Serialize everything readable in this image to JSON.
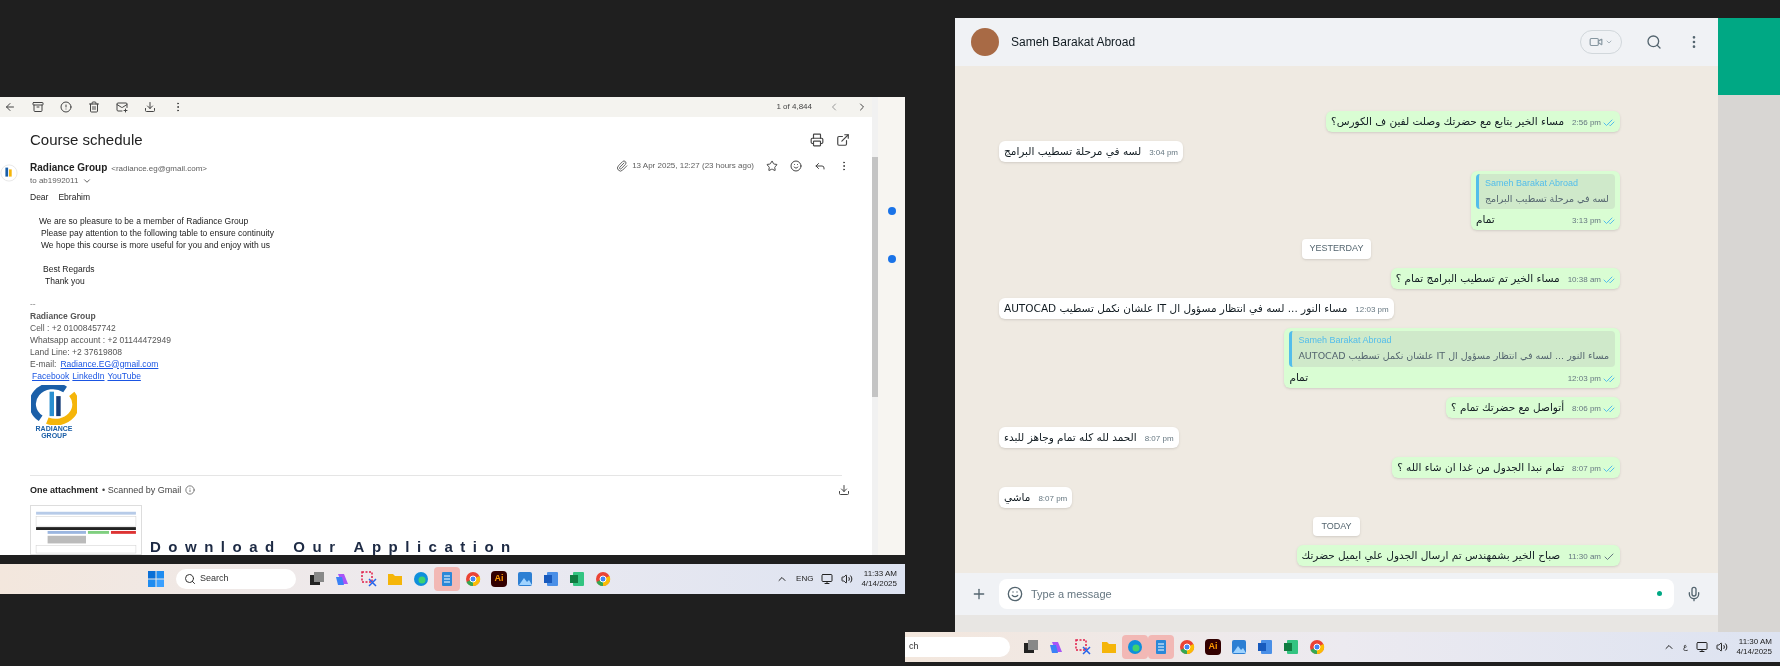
{
  "email": {
    "toolbar": {
      "counter": "1 of 4,844"
    },
    "subject": "Course schedule",
    "sender": {
      "name": "Radiance Group",
      "address": "<radiance.eg@gmail.com>",
      "to": "to ab1992011",
      "date": "13 Apr 2025, 12:27 (23 hours ago)",
      "has_attachment": true
    },
    "greeting": [
      "Dear",
      "Ebrahim"
    ],
    "body": [
      "We are so pleasure to be a member of Radiance Group",
      "Please pay attention to the following table to ensure continuity",
      "We hope this course is more useful for you and enjoy with us"
    ],
    "closing": [
      "Best Regards",
      "Thank you"
    ],
    "signature": {
      "separator": "--",
      "name": "Radiance Group",
      "lines": [
        "Cell : +2 01008457742",
        "Whatsapp account : +2 01144472949",
        "Land Line: +2 37619808"
      ],
      "email_label": "E-mail:",
      "email": "Radiance.EG@gmail.com",
      "links": [
        "Facebook",
        "LinkedIn",
        "YouTube"
      ],
      "logo": [
        "RADIANCE",
        "GROUP"
      ]
    },
    "attachments": {
      "heading": "One attachment",
      "note": "• Scanned by Gmail"
    },
    "overlay_text": "Download Our Application"
  },
  "left_taskbar": {
    "search": "Search",
    "apps": [
      {
        "kind": "taskview",
        "selected": false
      },
      {
        "kind": "copilot",
        "selected": false
      },
      {
        "kind": "snip",
        "selected": false
      },
      {
        "kind": "folder",
        "selected": false
      },
      {
        "kind": "edge",
        "selected": false
      },
      {
        "kind": "notepad",
        "selected": true
      },
      {
        "kind": "chrome",
        "selected": false
      },
      {
        "kind": "illustrator",
        "selected": false,
        "label": "Ai"
      },
      {
        "kind": "photos",
        "selected": false
      },
      {
        "kind": "word",
        "selected": false
      },
      {
        "kind": "excel",
        "selected": false
      },
      {
        "kind": "chrome",
        "selected": false
      }
    ],
    "language": "ENG",
    "time": "11:33 AM",
    "date": "4/14/2025"
  },
  "chat": {
    "contact": "Sameh Barakat Abroad",
    "messages": [
      {
        "kind": "out",
        "text": "مساء الخير بتابع مع حضرتك وصلت لفين ف الكورس؟",
        "time": "2:56 pm",
        "read": true
      },
      {
        "kind": "in",
        "text": "لسه في مرحلة تسطيب البرامج",
        "time": "3:04 pm"
      },
      {
        "kind": "out",
        "quote": {
          "author": "Sameh Barakat Abroad",
          "text": "لسه في مرحلة تسطيب البرامج"
        },
        "text": "تمام",
        "time": "3:13 pm",
        "read": true
      },
      {
        "kind": "date",
        "text": "YESTERDAY"
      },
      {
        "kind": "out",
        "text": "مساء الخير تم تسطيب البرامج تمام ؟",
        "time": "10:38 am",
        "read": true
      },
      {
        "kind": "in",
        "text": "مساء النور ... لسه في انتظار مسؤول ال IT علشان نكمل تسطيب AUTOCAD",
        "time": "12:03 pm"
      },
      {
        "kind": "out",
        "quote": {
          "author": "Sameh Barakat Abroad",
          "text": "مساء النور ... لسه في انتظار مسؤول ال IT علشان نكمل تسطيب AUTOCAD"
        },
        "text": "تمام",
        "time": "12:03 pm",
        "read": true
      },
      {
        "kind": "out",
        "text": "أتواصل مع حضرتك تمام ؟",
        "time": "8:06 pm",
        "read": true
      },
      {
        "kind": "in",
        "text": "الحمد لله كله تمام وجاهز للبدء",
        "time": "8:07 pm"
      },
      {
        "kind": "out",
        "text": "تمام نبدا الجدول من غدا ان شاء الله ؟",
        "time": "8:07 pm",
        "read": true
      },
      {
        "kind": "in",
        "text": "ماشي",
        "time": "8:07 pm"
      },
      {
        "kind": "date",
        "text": "TODAY"
      },
      {
        "kind": "out",
        "text": "صباح الخير بشمهندس تم ارسال الجدول علي ايميل حضرتك",
        "time": "11:30 am",
        "read": false
      }
    ],
    "composer": {
      "placeholder": "Type a message"
    }
  },
  "right_taskbar": {
    "search": "ch",
    "apps": [
      {
        "kind": "taskview",
        "selected": false
      },
      {
        "kind": "copilot",
        "selected": false
      },
      {
        "kind": "snip",
        "selected": false
      },
      {
        "kind": "folder",
        "selected": false
      },
      {
        "kind": "edge",
        "selected": true
      },
      {
        "kind": "notepad",
        "selected": true
      },
      {
        "kind": "chrome",
        "selected": false
      },
      {
        "kind": "illustrator",
        "selected": false,
        "label": "Ai"
      },
      {
        "kind": "photos",
        "selected": false
      },
      {
        "kind": "word",
        "selected": false
      },
      {
        "kind": "excel",
        "selected": false
      },
      {
        "kind": "chrome",
        "selected": false
      }
    ],
    "language": "ع",
    "time": "11:30 AM",
    "date": "4/14/2025"
  }
}
